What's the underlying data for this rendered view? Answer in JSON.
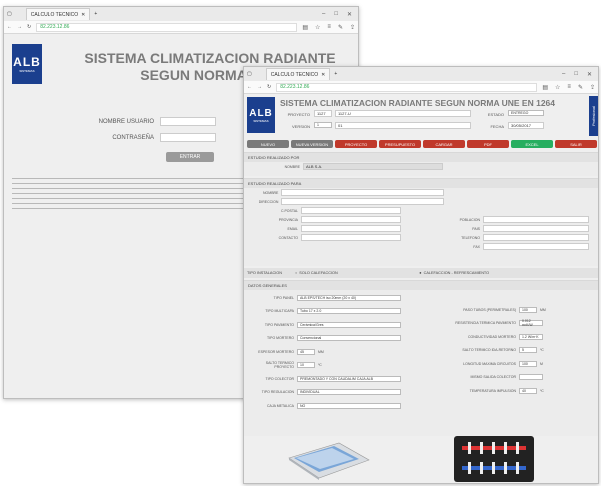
{
  "browser1": {
    "tab_title": "CALCULO TECNICO",
    "url": "82.223.12.86"
  },
  "browser2": {
    "tab_title": "CALCULO TECNICO",
    "url": "82.223.12.86"
  },
  "win_buttons": {
    "min": "–",
    "max": "□",
    "close": "✕"
  },
  "logo": {
    "text": "ALB",
    "sub": "SISTEMAS"
  },
  "login": {
    "title_line1": "SISTEMA CLIMATIZACION RADIANTE",
    "title_line2": "SEGUN NORMA UNE",
    "user_label": "NOMBRE USUARIO",
    "pass_label": "CONTRASEÑA",
    "enter_label": "ENTRAR"
  },
  "app": {
    "title": "SISTEMA CLIMATIZACION RADIANTE SEGUN NORMA UNE EN 1264",
    "side_label": "Profesional",
    "header": {
      "project_label": "PROYECTO",
      "project_code": "1127",
      "project_value": "1127-U",
      "version_label": "VERSION",
      "version_num": "1",
      "version_value": "01",
      "status_label": "ESTADO",
      "status_value": "ENTREGO",
      "date_label": "FECHA",
      "date_value": "30/05/2017"
    },
    "toolbar": [
      {
        "label": "NUEVO",
        "color": "#7a7a7a"
      },
      {
        "label": "NUEVA VERSION",
        "color": "#7a7a7a"
      },
      {
        "label": "PROYECTO",
        "color": "#c0392b"
      },
      {
        "label": "PRESUPUESTO",
        "color": "#c0392b"
      },
      {
        "label": "CARGAR",
        "color": "#c0392b"
      },
      {
        "label": "PDF",
        "color": "#c0392b"
      },
      {
        "label": "EXCEL",
        "color": "#27ae60"
      },
      {
        "label": "SALIR",
        "color": "#c0392b"
      }
    ],
    "sec_user": {
      "heading": "ESTUDIO REALIZADO POR",
      "name_label": "NOMBRE",
      "name_value": "ALB S.A."
    },
    "sec_client": {
      "heading": "ESTUDIO REALIZADO PARA",
      "fields_left": [
        "NOMBRE",
        "DIRECCION",
        "C.POSTAL",
        "PROVINCIA",
        "EMAIL",
        "CONTACTO"
      ],
      "fields_right": [
        "POBLACION",
        "PAIS",
        "TELEFONO",
        "FAX"
      ]
    },
    "install": {
      "label": "TIPO INSTALACION",
      "opt1": "SOLO CALEFACCION",
      "opt2": "CALEFACCION - REFRESCAMIENTO"
    },
    "sec_general": {
      "heading": "DATOS GENERALES",
      "left": [
        {
          "label": "TIPO PANEL",
          "value": "ALB EPS/TECH iso 20mm (20 x 40)"
        },
        {
          "label": "TIPO MULTICAPA",
          "value": "Tubo 17 x 2.0"
        },
        {
          "label": "TIPO PAVIMENTO",
          "value": "Cerámica/Gres"
        },
        {
          "label": "TIPO MORTERO",
          "value": "Convencional"
        },
        {
          "label": "ESPESOR MORTERO",
          "value": "45",
          "unit": "mm"
        },
        {
          "label": "SALTO TERMICO PROYECTO",
          "value": "10",
          "unit": "ºC"
        },
        {
          "label": "TIPO COLECTOR",
          "value": "PREMONTADO Y CON CAUDALIM CAJA ALB"
        },
        {
          "label": "TIPO REGULACION",
          "value": "INDIVIDUAL"
        },
        {
          "label": "CAJA METALICA",
          "value": "NO"
        }
      ],
      "right": [
        {
          "label": "PASO TUBOS (PERIMETRALES)",
          "value": "100",
          "unit": "mm"
        },
        {
          "label": "RESISTENCIA TERMICA PAVIMENTO",
          "value": "0.012 m²K/W"
        },
        {
          "label": "CONDUCTIVIDAD MORTERO",
          "value": "1.2 W/m·K"
        },
        {
          "label": "SALTO TERMICO IDA-RETORNO",
          "value": "5",
          "unit": "ºC"
        },
        {
          "label": "LONGITUD MAXIMA CIRCUITOS",
          "value": "100",
          "unit": "m"
        },
        {
          "label": "MISMO SALIDA COLECTOR",
          "value": ""
        },
        {
          "label": "TEMPERATURA IMPULSION",
          "value": "40",
          "unit": "ºC"
        }
      ]
    }
  }
}
